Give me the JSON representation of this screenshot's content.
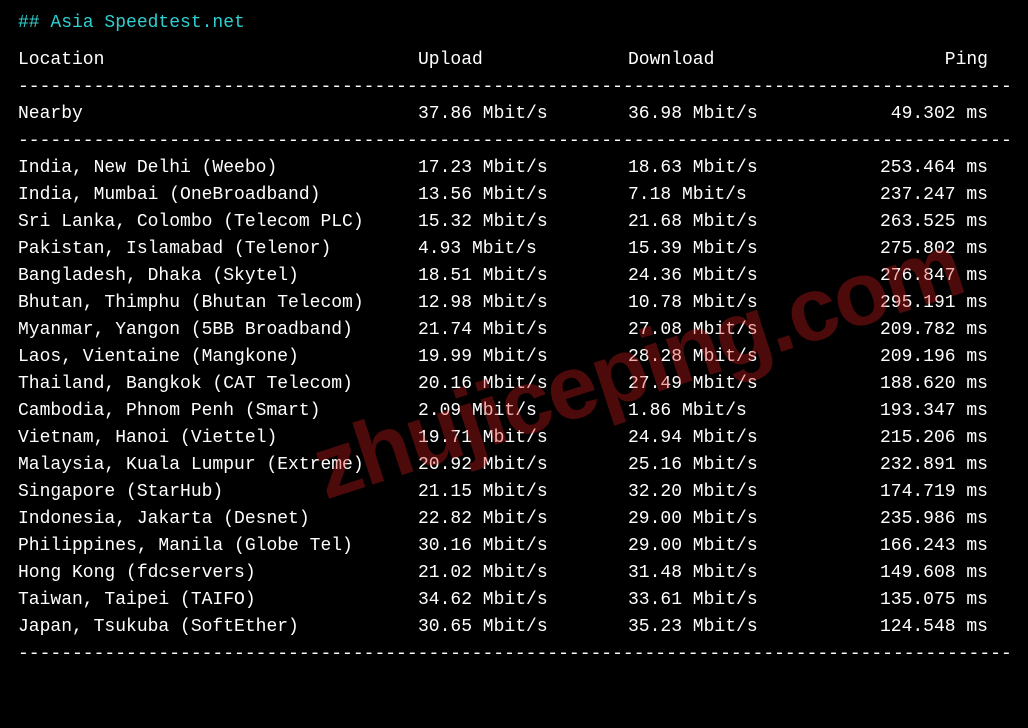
{
  "title": "## Asia Speedtest.net",
  "columns": {
    "location": "Location",
    "upload": "Upload",
    "download": "Download",
    "ping": "Ping"
  },
  "divider": "--------------------------------------------------------------------------------------------",
  "nearby": {
    "location": "Nearby",
    "upload": "37.86 Mbit/s",
    "download": "36.98 Mbit/s",
    "ping": "49.302 ms"
  },
  "rows": [
    {
      "location": "India, New Delhi (Weebo)",
      "upload": "17.23 Mbit/s",
      "download": "18.63 Mbit/s",
      "ping": "253.464 ms"
    },
    {
      "location": "India, Mumbai (OneBroadband)",
      "upload": "13.56 Mbit/s",
      "download": "7.18 Mbit/s",
      "ping": "237.247 ms"
    },
    {
      "location": "Sri Lanka, Colombo (Telecom PLC)",
      "upload": "15.32 Mbit/s",
      "download": "21.68 Mbit/s",
      "ping": "263.525 ms"
    },
    {
      "location": "Pakistan, Islamabad (Telenor)",
      "upload": "4.93 Mbit/s",
      "download": "15.39 Mbit/s",
      "ping": "275.802 ms"
    },
    {
      "location": "Bangladesh, Dhaka (Skytel)",
      "upload": "18.51 Mbit/s",
      "download": "24.36 Mbit/s",
      "ping": "276.847 ms"
    },
    {
      "location": "Bhutan, Thimphu (Bhutan Telecom)",
      "upload": "12.98 Mbit/s",
      "download": "10.78 Mbit/s",
      "ping": "295.191 ms"
    },
    {
      "location": "Myanmar, Yangon (5BB Broadband)",
      "upload": "21.74 Mbit/s",
      "download": "27.08 Mbit/s",
      "ping": "209.782 ms"
    },
    {
      "location": "Laos, Vientaine (Mangkone)",
      "upload": "19.99 Mbit/s",
      "download": "28.28 Mbit/s",
      "ping": "209.196 ms"
    },
    {
      "location": "Thailand, Bangkok (CAT Telecom)",
      "upload": "20.16 Mbit/s",
      "download": "27.49 Mbit/s",
      "ping": "188.620 ms"
    },
    {
      "location": "Cambodia, Phnom Penh (Smart)",
      "upload": "2.09 Mbit/s",
      "download": "1.86 Mbit/s",
      "ping": "193.347 ms"
    },
    {
      "location": "Vietnam, Hanoi (Viettel)",
      "upload": "19.71 Mbit/s",
      "download": "24.94 Mbit/s",
      "ping": "215.206 ms"
    },
    {
      "location": "Malaysia, Kuala Lumpur (Extreme)",
      "upload": "20.92 Mbit/s",
      "download": "25.16 Mbit/s",
      "ping": "232.891 ms"
    },
    {
      "location": "Singapore (StarHub)",
      "upload": "21.15 Mbit/s",
      "download": "32.20 Mbit/s",
      "ping": "174.719 ms"
    },
    {
      "location": "Indonesia, Jakarta (Desnet)",
      "upload": "22.82 Mbit/s",
      "download": "29.00 Mbit/s",
      "ping": "235.986 ms"
    },
    {
      "location": "Philippines, Manila (Globe Tel)",
      "upload": "30.16 Mbit/s",
      "download": "29.00 Mbit/s",
      "ping": "166.243 ms"
    },
    {
      "location": "Hong Kong (fdcservers)",
      "upload": "21.02 Mbit/s",
      "download": "31.48 Mbit/s",
      "ping": "149.608 ms"
    },
    {
      "location": "Taiwan, Taipei (TAIFO)",
      "upload": "34.62 Mbit/s",
      "download": "33.61 Mbit/s",
      "ping": "135.075 ms"
    },
    {
      "location": "Japan, Tsukuba (SoftEther)",
      "upload": "30.65 Mbit/s",
      "download": "35.23 Mbit/s",
      "ping": "124.548 ms"
    }
  ],
  "watermark": "zhujiceping.com"
}
